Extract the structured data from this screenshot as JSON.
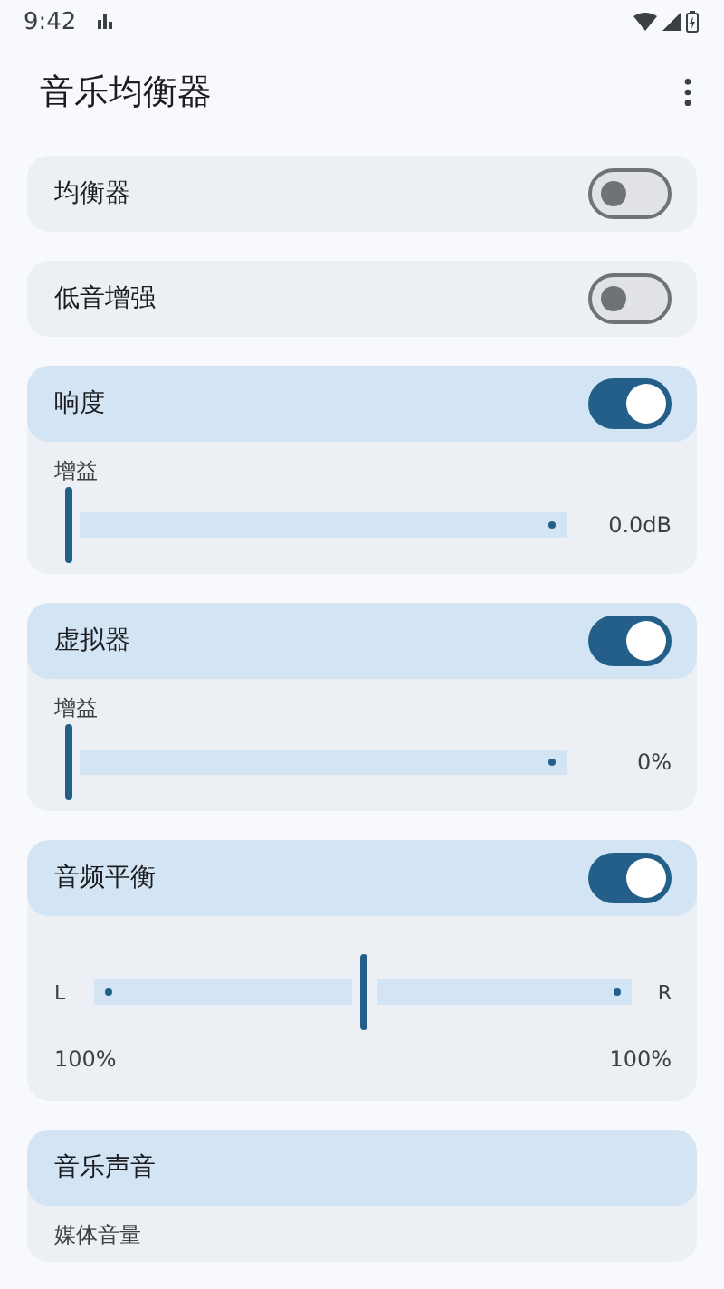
{
  "status_bar": {
    "time": "9:42"
  },
  "app_bar": {
    "title": "音乐均衡器"
  },
  "cards": [
    {
      "kind": "switch",
      "title": "均衡器",
      "on": false
    },
    {
      "kind": "switch",
      "title": "低音增强",
      "on": false
    },
    {
      "kind": "slider",
      "title": "响度",
      "on": true,
      "slider_label": "增益",
      "level": 0,
      "reading": "0.0dB"
    },
    {
      "kind": "slider",
      "title": "虚拟器",
      "on": true,
      "slider_label": "增益",
      "level": 0,
      "reading": "0%"
    },
    {
      "kind": "balance",
      "title": "音频平衡",
      "on": true,
      "left_label": "L",
      "right_label": "R",
      "level": 0.5,
      "left_reading": "100%",
      "right_reading": "100%"
    },
    {
      "kind": "partial",
      "title": "音乐声音",
      "slider_label": "媒体音量"
    }
  ]
}
